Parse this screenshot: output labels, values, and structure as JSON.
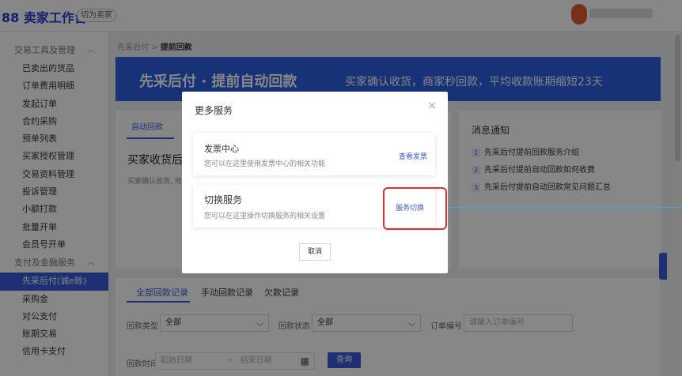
{
  "header": {
    "logo": "88 卖家工作台",
    "switch_label": "切为卖家"
  },
  "sidebar": {
    "group1": "交易工具及管理",
    "items1": [
      "已卖出的货品",
      "订单费用明细",
      "发起订单",
      "合约采购",
      "预单列表",
      "买家授权管理",
      "交易资料管理",
      "投诉管理",
      "小额打款",
      "批量开单",
      "会员号开单"
    ],
    "group2": "支付及金融服务",
    "items2": [
      "先采后付(诚e赊)",
      "采购金",
      "对公支付",
      "账期交易",
      "信用卡支付"
    ]
  },
  "breadcrumb": {
    "root": "先采后付",
    "sep": ">",
    "current": "提前回款"
  },
  "banner": {
    "title": "先采后付 · 提前自动回款",
    "subtitle": "买家确认收货，商家秒回款，平均收款账期缩短23天"
  },
  "left_card": {
    "tab": "自动回款",
    "heading": "买家收货后",
    "desc": "买家确认收货, 地"
  },
  "notices": {
    "title": "消息通知",
    "items": [
      "先采后付提前回款服务介绍",
      "先采后付提前自动回款如何收费",
      "先采后付提前自动回款常见问题汇总"
    ]
  },
  "records": {
    "tabs": [
      "全部回款记录",
      "手动回款记录",
      "欠款记录"
    ],
    "type_label": "回款类型",
    "type_value": "全部",
    "status_label": "回款状态",
    "status_value": "全部",
    "order_label": "订单编号",
    "order_placeholder": "请输入订单编号",
    "time_label": "回款时间",
    "start_placeholder": "起始日期",
    "dash": "~",
    "end_placeholder": "结束日期",
    "query_label": "查询"
  },
  "modal": {
    "title": "更多服务",
    "close": "×",
    "service1": {
      "name": "发票中心",
      "desc": "您可以在这里使用发票中心的相关功能",
      "link": "查看发票"
    },
    "service2": {
      "name": "切换服务",
      "desc": "您可以在这里操作切换服务的相关设置",
      "link": "服务切换"
    },
    "cancel": "取消"
  }
}
